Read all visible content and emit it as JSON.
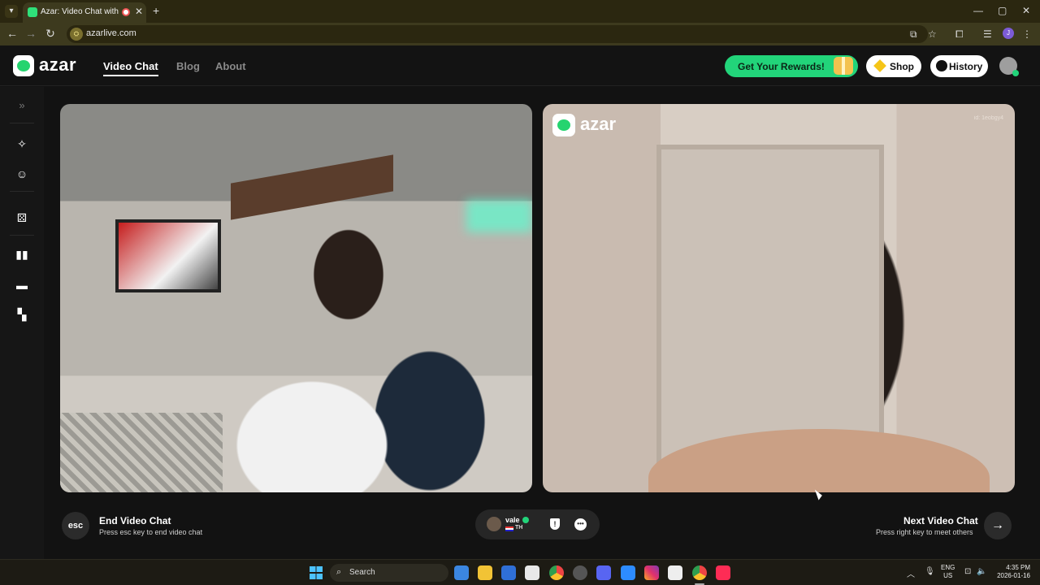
{
  "browser": {
    "tab_title": "Azar: Video Chat with New",
    "url": "azarlive.com",
    "profile_initial": "J"
  },
  "header": {
    "logo_text": "azar",
    "nav": [
      "Video Chat",
      "Blog",
      "About"
    ],
    "rewards_label": "Get Your Rewards!",
    "shop_label": "Shop",
    "history_label": "History"
  },
  "remote_video": {
    "watermark_text": "azar",
    "watermark_id": "id: 1eobgy4"
  },
  "controls": {
    "esc_key": "esc",
    "end_title": "End Video Chat",
    "end_sub": "Press esc key to end video chat",
    "peer_name": "vale",
    "peer_country": "TH",
    "next_title": "Next Video Chat",
    "next_sub": "Press right key to meet others"
  },
  "taskbar": {
    "search_label": "Search",
    "lang_top": "ENG",
    "lang_bottom": "US",
    "time": "4:35 PM",
    "date": "2026-01-16"
  },
  "colors": {
    "accent": "#22d47a",
    "chrome_bg": "#2b2710"
  }
}
